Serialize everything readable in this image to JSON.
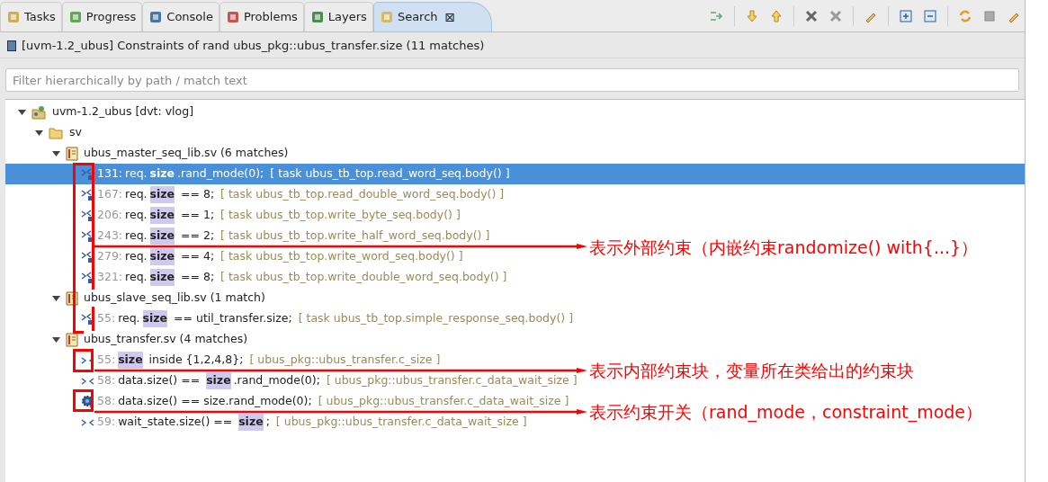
{
  "tabs": [
    {
      "label": "Tasks",
      "selected": false
    },
    {
      "label": "Progress",
      "selected": false
    },
    {
      "label": "Console",
      "selected": false
    },
    {
      "label": "Problems",
      "selected": false
    },
    {
      "label": "Layers",
      "selected": false
    },
    {
      "label": "Search",
      "selected": true,
      "close": "⊠"
    }
  ],
  "result_title": "[uvm-1.2_ubus] Constraints of rand ubus_pkg::ubus_transfer.size (11 matches)",
  "filter": {
    "placeholder": "Filter hierarchically by path / match text"
  },
  "tree": [
    {
      "kind": "project",
      "label": "uvm-1.2_ubus [dvt: vlog]",
      "expanded": true,
      "children": [
        {
          "kind": "folder",
          "label": "sv",
          "expanded": true,
          "children": [
            {
              "kind": "file",
              "label": "ubus_master_seq_lib.sv (6 matches)",
              "expanded": true,
              "children": [
                {
                  "kind": "external",
                  "line": "131:",
                  "selected": true,
                  "code": [
                    {
                      "text": "req."
                    },
                    {
                      "text": "size",
                      "match": true
                    },
                    {
                      "text": ".rand_mode(0);"
                    }
                  ],
                  "context": "[ task ubus_tb_top.read_word_seq.body() ]"
                },
                {
                  "kind": "external",
                  "line": "167:",
                  "selected": false,
                  "code": [
                    {
                      "text": "req."
                    },
                    {
                      "text": "size",
                      "match": true
                    },
                    {
                      "text": " == 8;"
                    }
                  ],
                  "context": "[ task ubus_tb_top.read_double_word_seq.body() ]"
                },
                {
                  "kind": "external",
                  "line": "206:",
                  "selected": false,
                  "code": [
                    {
                      "text": "req."
                    },
                    {
                      "text": "size",
                      "match": true
                    },
                    {
                      "text": " == 1;"
                    }
                  ],
                  "context": "[ task ubus_tb_top.write_byte_seq.body() ]"
                },
                {
                  "kind": "external",
                  "line": "243:",
                  "selected": false,
                  "code": [
                    {
                      "text": "req."
                    },
                    {
                      "text": "size",
                      "match": true
                    },
                    {
                      "text": " == 2;"
                    }
                  ],
                  "context": "[ task ubus_tb_top.write_half_word_seq.body() ]"
                },
                {
                  "kind": "external",
                  "line": "279:",
                  "selected": false,
                  "code": [
                    {
                      "text": "req."
                    },
                    {
                      "text": "size",
                      "match": true
                    },
                    {
                      "text": " == 4;"
                    }
                  ],
                  "context": "[ task ubus_tb_top.write_word_seq.body() ]"
                },
                {
                  "kind": "external",
                  "line": "321:",
                  "selected": false,
                  "code": [
                    {
                      "text": "req."
                    },
                    {
                      "text": "size",
                      "match": true
                    },
                    {
                      "text": " == 8;"
                    }
                  ],
                  "context": "[ task ubus_tb_top.write_double_word_seq.body() ]"
                }
              ]
            },
            {
              "kind": "file",
              "label": "ubus_slave_seq_lib.sv (1 match)",
              "expanded": true,
              "children": [
                {
                  "kind": "external",
                  "line": "55:",
                  "selected": false,
                  "code": [
                    {
                      "text": "req."
                    },
                    {
                      "text": "size",
                      "match": true
                    },
                    {
                      "text": " == util_transfer.size;"
                    }
                  ],
                  "context": "[ task ubus_tb_top.simple_response_seq.body() ]"
                }
              ]
            },
            {
              "kind": "file",
              "label": "ubus_transfer.sv (4 matches)",
              "expanded": true,
              "children": [
                {
                  "kind": "internal",
                  "line": "55:",
                  "selected": false,
                  "code": [
                    {
                      "text": "size",
                      "match": true
                    },
                    {
                      "text": " inside {1,2,4,8};"
                    }
                  ],
                  "context": "[ ubus_pkg::ubus_transfer.c_size ]"
                },
                {
                  "kind": "internal",
                  "line": "58:",
                  "selected": false,
                  "code": [
                    {
                      "text": "data.size() == "
                    },
                    {
                      "text": "size",
                      "match": true
                    },
                    {
                      "text": ".rand_mode(0);"
                    }
                  ],
                  "context": "[ ubus_pkg::ubus_transfer.c_data_wait_size ]"
                },
                {
                  "kind": "switch",
                  "line": "58:",
                  "selected": false,
                  "code": [
                    {
                      "text": "data.size() == size.rand_mode(0);"
                    }
                  ],
                  "context": "[ ubus_pkg::ubus_transfer.c_data_wait_size ]"
                },
                {
                  "kind": "internal",
                  "line": "59:",
                  "selected": false,
                  "code": [
                    {
                      "text": "wait_state.size() == "
                    },
                    {
                      "text": "size",
                      "match": true
                    },
                    {
                      "text": ";"
                    }
                  ],
                  "context": "[ ubus_pkg::ubus_transfer.c_data_wait_size ]"
                }
              ]
            }
          ]
        }
      ]
    }
  ],
  "annotations": [
    "表示外部约束（内嵌约束randomize() with{...}）",
    "表示内部约束块，变量所在类给出的约束块",
    "表示约束开关（rand_mode，constraint_mode）"
  ]
}
